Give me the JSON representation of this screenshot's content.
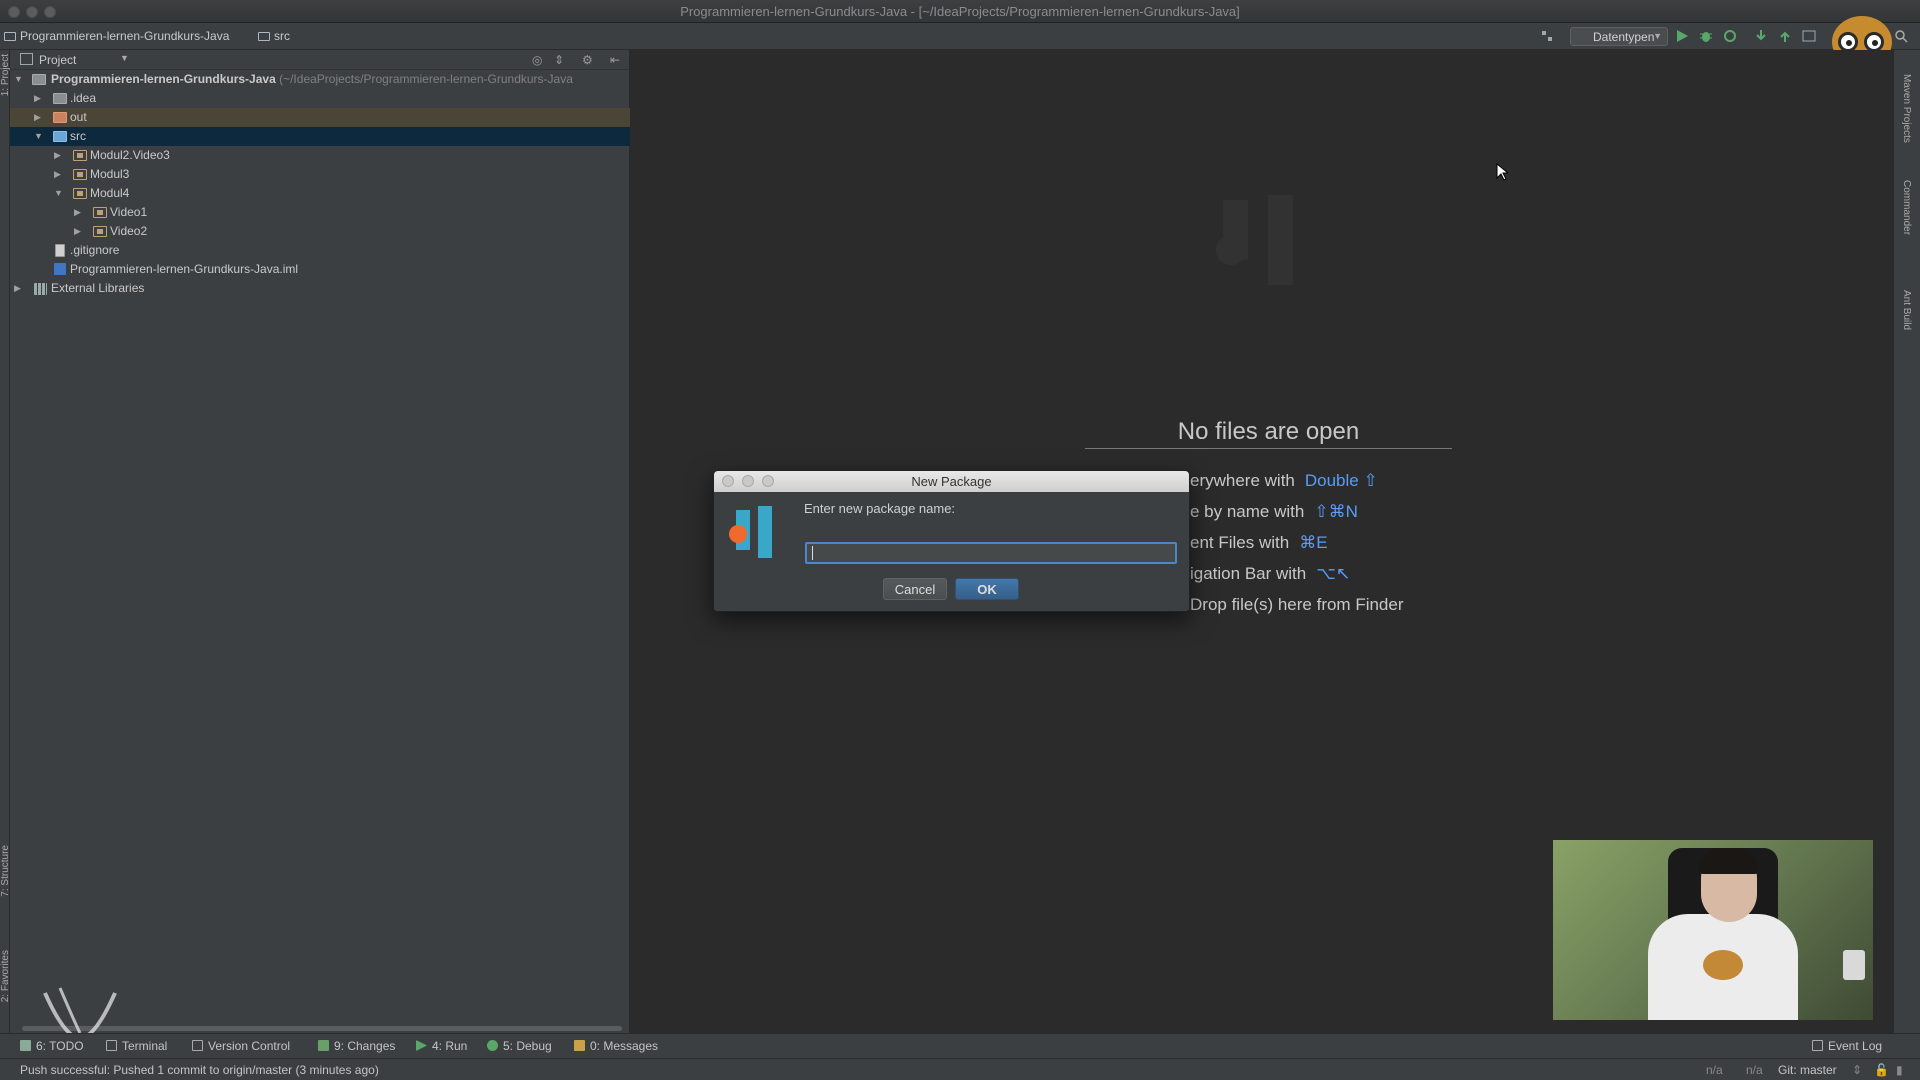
{
  "window": {
    "title": "Programmieren-lernen-Grundkurs-Java - [~/IdeaProjects/Programmieren-lernen-Grundkurs-Java]"
  },
  "navbar": {
    "project_crumb": "Programmieren-lernen-Grundkurs-Java",
    "src_crumb": "src",
    "run_config": "Datentypen"
  },
  "project_panel": {
    "header_label": "Project",
    "tree": {
      "root_name": "Programmieren-lernen-Grundkurs-Java",
      "root_path": "(~/IdeaProjects/Programmieren-lernen-Grundkurs-Java",
      "idea": ".idea",
      "out": "out",
      "src": "src",
      "modul2": "Modul2.Video3",
      "modul3": "Modul3",
      "modul4": "Modul4",
      "video1": "Video1",
      "video2": "Video2",
      "gitignore": ".gitignore",
      "iml": "Programmieren-lernen-Grundkurs-Java.iml",
      "ext_libs": "External Libraries"
    }
  },
  "side_stripes": {
    "left_top": "1: Project",
    "left_structure": "7: Structure",
    "left_favorites": "2: Favorites",
    "right_maven": "Maven Projects",
    "right_commander": "Commander",
    "right_ant": "Ant Build"
  },
  "editor": {
    "empty_title": "No files are open",
    "hints": [
      {
        "text": "erywhere with",
        "key": "Double ⇧"
      },
      {
        "text": "e by name with",
        "key": "⇧⌘N"
      },
      {
        "text": "ent Files with",
        "key": "⌘E"
      },
      {
        "text": "igation Bar with",
        "key": "⌥↖"
      },
      {
        "text": "Drop file(s) here from Finder",
        "key": ""
      }
    ]
  },
  "dialog": {
    "title": "New Package",
    "prompt": "Enter new package name:",
    "input_value": "",
    "cancel_label": "Cancel",
    "ok_label": "OK"
  },
  "tool_windows": {
    "todo": "6: TODO",
    "terminal": "Terminal",
    "vcs": "Version Control",
    "changes": "9: Changes",
    "run": "4: Run",
    "debug": "5: Debug",
    "messages": "0: Messages",
    "event_log": "Event Log"
  },
  "status": {
    "message": "Push successful: Pushed 1 commit to origin/master (3 minutes ago)",
    "na1": "n/a",
    "na2": "n/a",
    "git": "Git: master"
  },
  "colors": {
    "selection": "#0d293e",
    "accent_key": "#589df6",
    "dialog_focus": "#4a88c7"
  }
}
